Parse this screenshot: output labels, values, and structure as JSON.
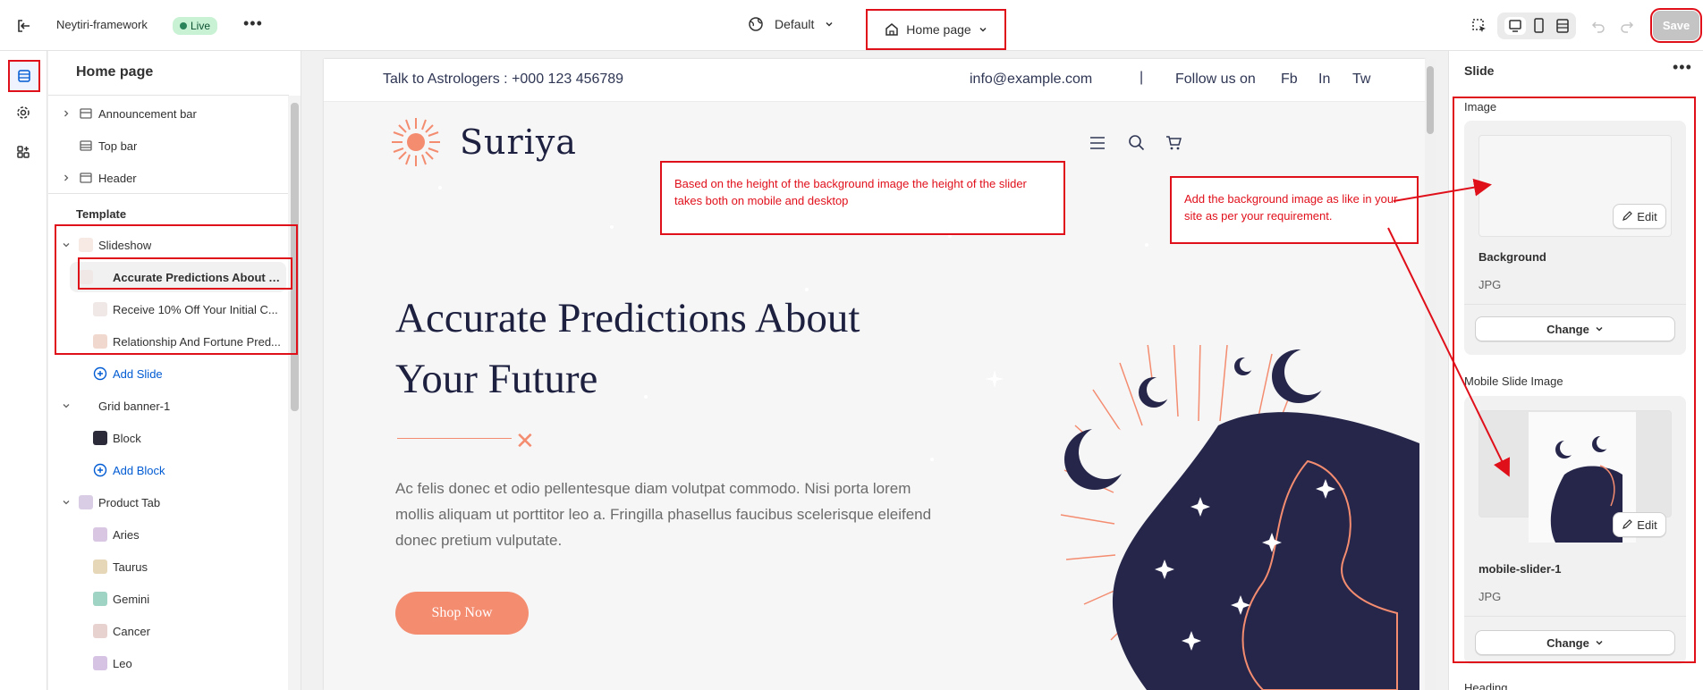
{
  "topbar": {
    "store_name": "Neytiri-framework",
    "status_badge": "Live",
    "more_label": "•••",
    "theme_label": "Default",
    "page_label": "Home page",
    "save_label": "Save"
  },
  "sidebar": {
    "title": "Home page",
    "sections": {
      "announcement_bar": "Announcement bar",
      "top_bar": "Top bar",
      "header": "Header",
      "template_heading": "Template",
      "slideshow": "Slideshow",
      "slides": [
        "Accurate Predictions About Y...",
        "Receive 10% Off Your Initial C...",
        "Relationship And Fortune Pred..."
      ],
      "add_slide": "Add Slide",
      "grid_banner": "Grid banner-1",
      "block": "Block",
      "add_block": "Add Block",
      "product_tab": "Product Tab",
      "product_items": [
        "Aries",
        "Taurus",
        "Gemini",
        "Cancer",
        "Leo"
      ]
    }
  },
  "preview": {
    "topbar": {
      "phone": "Talk to Astrologers : +000 123 456789",
      "email": "info@example.com",
      "divider": "|",
      "follow": "Follow us on",
      "socials": [
        "Fb",
        "In",
        "Tw"
      ]
    },
    "logo_text": "Suriya",
    "hero_title": "Accurate Predictions About Your Future",
    "hero_text": "Ac felis donec et odio pellentesque diam volutpat commodo. Nisi porta lorem mollis aliquam ut porttitor leo a. Fringilla phasellus faucibus scelerisque eleifend donec pretium vulputate.",
    "shop_button": "Shop Now"
  },
  "annotations": {
    "left_note": "Based on the height of the background image the height of the slider takes both on mobile and desktop",
    "right_note": "Add the background image as like in your site as per your requirement."
  },
  "right_panel": {
    "title": "Slide",
    "image_label": "Image",
    "background_name": "Background",
    "background_type": "JPG",
    "edit_label": "Edit",
    "change_label": "Change",
    "mobile_label": "Mobile Slide Image",
    "mobile_name": "mobile-slider-1",
    "mobile_type": "JPG",
    "heading_label": "Heading"
  },
  "colors": {
    "accent": "#f48c70",
    "navy": "#1e2040",
    "annotation_red": "#e0101b",
    "link_blue": "#005bd3",
    "live_green": "#c9f2d4"
  }
}
